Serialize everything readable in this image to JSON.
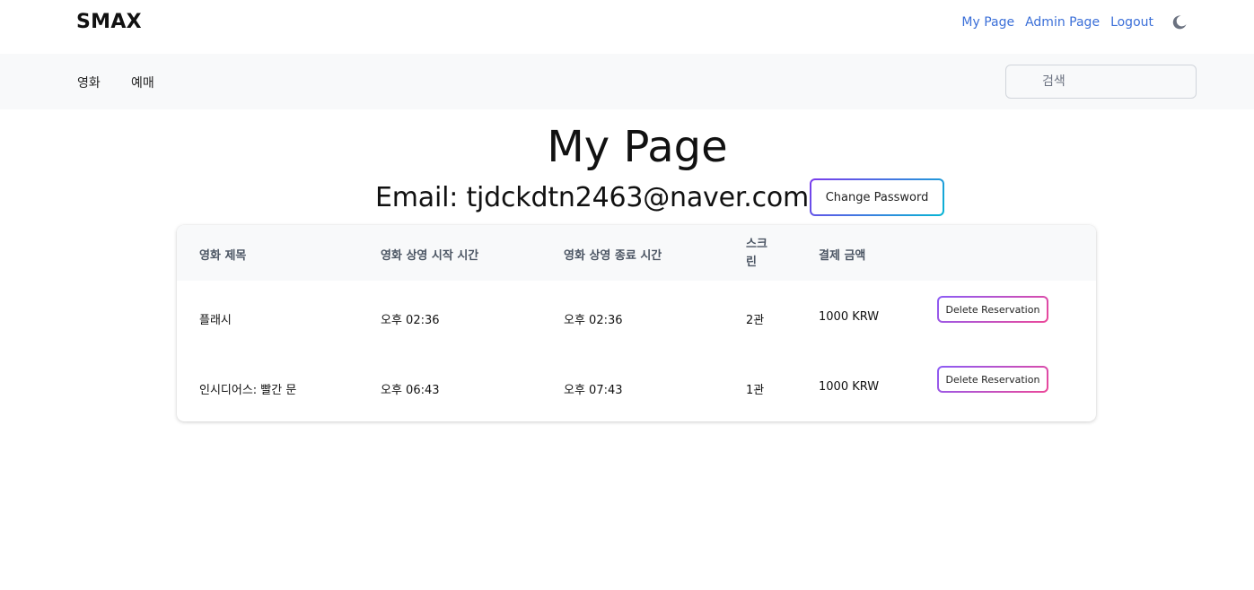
{
  "header": {
    "brand": "SMAX",
    "links": {
      "my_page": "My Page",
      "admin_page": "Admin Page",
      "logout": "Logout"
    },
    "theme_toggle_icon": "moon-icon"
  },
  "nav": {
    "items": [
      "영화",
      "예매"
    ],
    "search_placeholder": "검색",
    "search_value": ""
  },
  "main": {
    "title": "My Page",
    "email": "Email: tjdckdtn2463@naver.com",
    "change_password": "Change Password"
  },
  "table": {
    "columns": [
      "영화 제목",
      "영화 상영 시작 시간",
      "영화 상영 종료 시간",
      "스크\n린",
      "결제 금액",
      ""
    ],
    "rows": [
      {
        "title": "플래시",
        "start": "오후 02:36",
        "end": "오후 02:36",
        "screen": "2관",
        "amount": "1000 KRW",
        "action": "Delete Reservation"
      },
      {
        "title": "인시디어스: 빨간 문",
        "start": "오후 06:43",
        "end": "오후 07:43",
        "screen": "1관",
        "amount": "1000 KRW",
        "action": "Delete Reservation"
      }
    ]
  },
  "colors": {
    "link": "#3b6fd8",
    "nav_bg": "#f8f9fa",
    "button_gradient_start": "#7c3aed",
    "button_gradient_end": "#06b6d4",
    "delete_gradient_start": "#8b5cf6",
    "delete_gradient_end": "#ec4899"
  }
}
